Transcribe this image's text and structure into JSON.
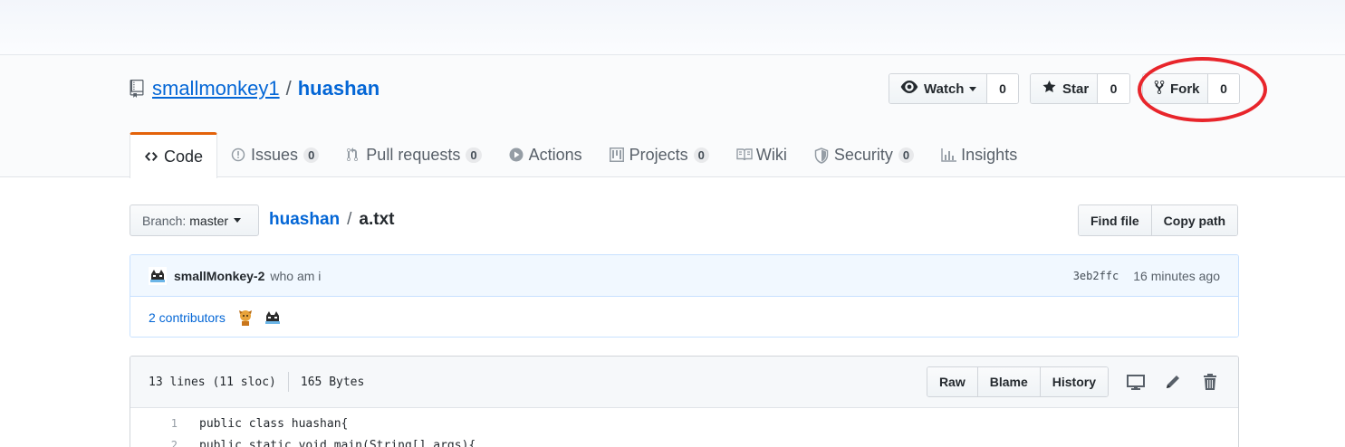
{
  "repo": {
    "owner": "smallmonkey1",
    "separator": "/",
    "name": "huashan"
  },
  "actions": {
    "watch_label": "Watch",
    "watch_count": "0",
    "star_label": "Star",
    "star_count": "0",
    "fork_label": "Fork",
    "fork_count": "0",
    "annotation_color": "#e8252b"
  },
  "tabs": [
    {
      "label": "Code",
      "icon": "code-icon",
      "counter": null
    },
    {
      "label": "Issues",
      "icon": "issue-icon",
      "counter": "0"
    },
    {
      "label": "Pull requests",
      "icon": "pull-request-icon",
      "counter": "0"
    },
    {
      "label": "Actions",
      "icon": "play-icon",
      "counter": null
    },
    {
      "label": "Projects",
      "icon": "project-icon",
      "counter": "0"
    },
    {
      "label": "Wiki",
      "icon": "book-icon",
      "counter": null
    },
    {
      "label": "Security",
      "icon": "shield-icon",
      "counter": "0"
    },
    {
      "label": "Insights",
      "icon": "graph-icon",
      "counter": null
    }
  ],
  "branch": {
    "prefix": "Branch:",
    "name": "master"
  },
  "path": {
    "repo": "huashan",
    "separator": "/",
    "file": "a.txt",
    "find_file": "Find file",
    "copy_path": "Copy path"
  },
  "commit": {
    "author": "smallMonkey-2",
    "message": "who am i",
    "sha": "3eb2ffc",
    "time": "16 minutes ago",
    "contributors": "2 contributors"
  },
  "file": {
    "lines_info": "13 lines (11 sloc)",
    "size": "165 Bytes",
    "raw": "Raw",
    "blame": "Blame",
    "history": "History",
    "code": [
      {
        "n": "1",
        "text": "public class huashan{"
      },
      {
        "n": "2",
        "text": "public static void main(String[] args){"
      }
    ]
  },
  "colors": {
    "link": "#0366d6",
    "tab_accent": "#e36209"
  }
}
